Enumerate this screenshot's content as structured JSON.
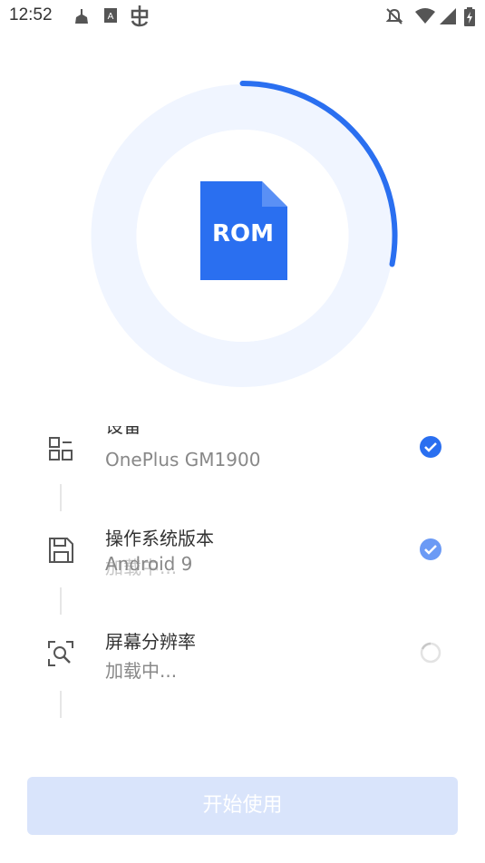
{
  "status_bar": {
    "time": "12:52"
  },
  "progress": {
    "fraction": 0.28,
    "center_label": "ROM",
    "accent_color": "#2a6ff0",
    "track_color": "#eef4ff"
  },
  "items": [
    {
      "title": "设备",
      "value": "OnePlus GM1900",
      "icon": "grid-icon",
      "state": "done"
    },
    {
      "title": "操作系统版本",
      "value": "Android 9",
      "ghost_text": "加载中...",
      "icon": "save-icon",
      "state": "done"
    },
    {
      "title": "屏幕分辨率",
      "value": "加载中...",
      "icon": "screen-search-icon",
      "state": "loading"
    }
  ],
  "start_button": {
    "label": "开始使用",
    "disabled": true,
    "color": "#d9e4fb"
  }
}
